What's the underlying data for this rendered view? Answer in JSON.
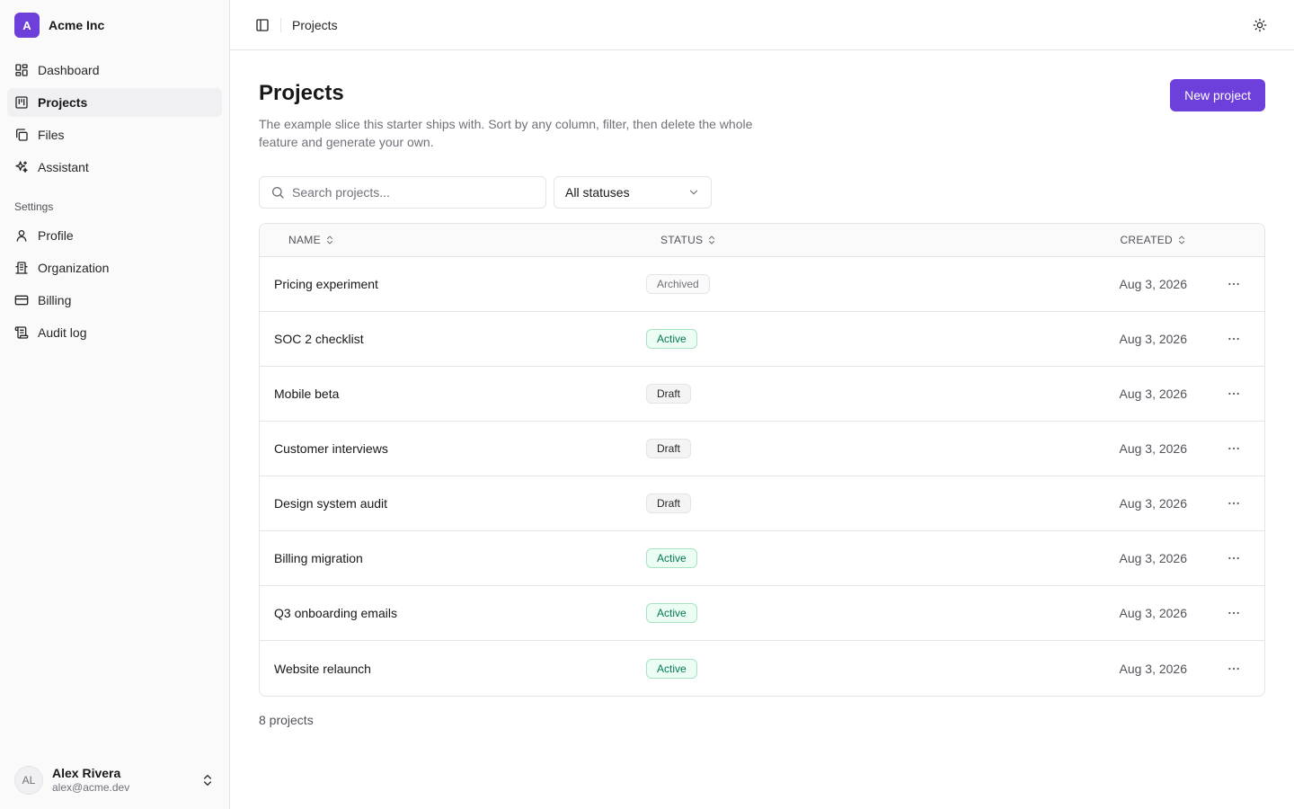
{
  "org": {
    "initial": "A",
    "name": "Acme Inc",
    "logo_color": "#6d3fdb"
  },
  "nav": [
    {
      "label": "Dashboard",
      "icon": "dashboard-icon",
      "active": false
    },
    {
      "label": "Projects",
      "icon": "projects-icon",
      "active": true
    },
    {
      "label": "Files",
      "icon": "files-icon",
      "active": false
    },
    {
      "label": "Assistant",
      "icon": "sparkles-icon",
      "active": false
    }
  ],
  "settings": {
    "label": "Settings",
    "items": [
      {
        "label": "Profile",
        "icon": "user-icon"
      },
      {
        "label": "Organization",
        "icon": "building-icon"
      },
      {
        "label": "Billing",
        "icon": "credit-card-icon"
      },
      {
        "label": "Audit log",
        "icon": "scroll-icon"
      }
    ]
  },
  "user": {
    "initials": "AL",
    "name": "Alex Rivera",
    "email": "alex@acme.dev"
  },
  "topbar": {
    "breadcrumb": "Projects"
  },
  "page": {
    "title": "Projects",
    "description": "The example slice this starter ships with. Sort by any column, filter, then delete the whole feature and generate your own.",
    "new_button": "New project"
  },
  "filters": {
    "search_placeholder": "Search projects...",
    "status_selected": "All statuses"
  },
  "table": {
    "columns": {
      "name": "NAME",
      "status": "STATUS",
      "created": "CREATED"
    },
    "rows": [
      {
        "name": "Pricing experiment",
        "status": "Archived",
        "created": "Aug 3, 2026"
      },
      {
        "name": "SOC 2 checklist",
        "status": "Active",
        "created": "Aug 3, 2026"
      },
      {
        "name": "Mobile beta",
        "status": "Draft",
        "created": "Aug 3, 2026"
      },
      {
        "name": "Customer interviews",
        "status": "Draft",
        "created": "Aug 3, 2026"
      },
      {
        "name": "Design system audit",
        "status": "Draft",
        "created": "Aug 3, 2026"
      },
      {
        "name": "Billing migration",
        "status": "Active",
        "created": "Aug 3, 2026"
      },
      {
        "name": "Q3 onboarding emails",
        "status": "Active",
        "created": "Aug 3, 2026"
      },
      {
        "name": "Website relaunch",
        "status": "Active",
        "created": "Aug 3, 2026"
      }
    ]
  },
  "footer": {
    "count": "8 projects"
  },
  "colors": {
    "accent": "#6d3fdb",
    "active_badge_bg": "#ecfdf3",
    "active_badge_text": "#047857",
    "draft_badge_bg": "#f4f4f5",
    "archived_badge_text": "#71717a"
  }
}
